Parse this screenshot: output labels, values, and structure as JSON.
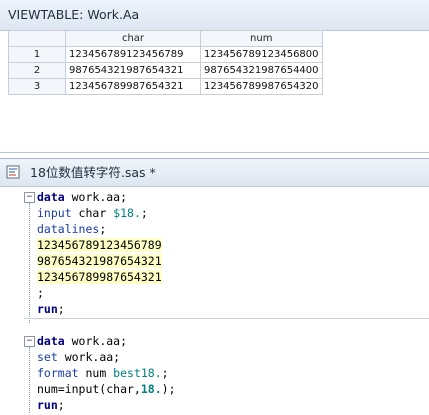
{
  "viewtable": {
    "title": "VIEWTABLE: Work.Aa",
    "columns": [
      "char",
      "num"
    ],
    "rows": [
      {
        "n": "1",
        "char": "123456789123456789",
        "num": "123456789123456800"
      },
      {
        "n": "2",
        "char": "987654321987654321",
        "num": "987654321987654400"
      },
      {
        "n": "3",
        "char": "123456789987654321",
        "num": "123456789987654320"
      }
    ]
  },
  "editor": {
    "title": "18位数值转字符.sas *",
    "step1": {
      "l1_kw": "data",
      "l1_rest": " work.aa;",
      "l2_kw": "input",
      "l2_mid": " char ",
      "l2_fmt": "$18.",
      "l2_end": ";",
      "l3_kw": "datalines",
      "l3_end": ";",
      "d1": "123456789123456789",
      "d2": "987654321987654321",
      "d3": "123456789987654321",
      "l7": ";",
      "l8_kw": "run",
      "l8_end": ";"
    },
    "step2": {
      "l1_kw": "data",
      "l1_rest": " work.aa;",
      "l2_kw": "set",
      "l2_rest": " work.aa;",
      "l3_kw": "format",
      "l3_mid": " num ",
      "l3_fmt": "best18.",
      "l3_end": ";",
      "l4_pre": "num=input(char,",
      "l4_num": "18.",
      "l4_end": ");",
      "l5_kw": "run",
      "l5_end": ";"
    },
    "fold_symbol": "−"
  }
}
